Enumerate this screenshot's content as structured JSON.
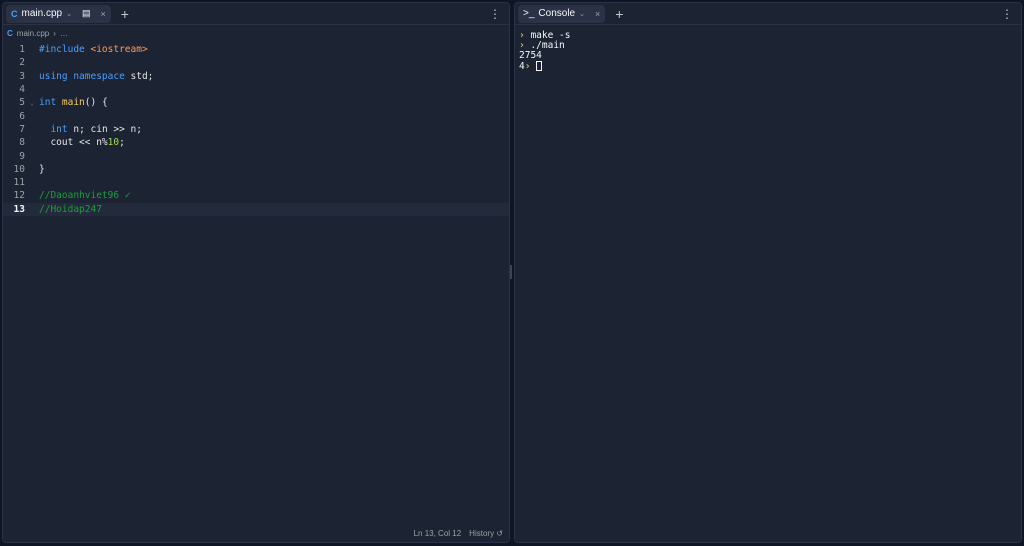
{
  "editor": {
    "tab_label": "main.cpp",
    "breadcrumb": [
      "main.cpp",
      "…"
    ],
    "lines": [
      {
        "n": "1",
        "parts": [
          [
            "kw",
            "#include "
          ],
          [
            "str",
            "<iostream>"
          ]
        ]
      },
      {
        "n": "2",
        "parts": []
      },
      {
        "n": "3",
        "parts": [
          [
            "kw",
            "using namespace "
          ],
          [
            "",
            "std;"
          ]
        ]
      },
      {
        "n": "4",
        "parts": []
      },
      {
        "n": "5",
        "parts": [
          [
            "kw",
            "int "
          ],
          [
            "fn",
            "main"
          ],
          [
            "",
            "() {"
          ]
        ]
      },
      {
        "n": "6",
        "parts": []
      },
      {
        "n": "7",
        "parts": [
          [
            "",
            "  "
          ],
          [
            "kw",
            "int"
          ],
          [
            "",
            " n; cin >> n;"
          ]
        ]
      },
      {
        "n": "8",
        "parts": [
          [
            "",
            "  cout << n%"
          ],
          [
            "num",
            "10"
          ],
          [
            "",
            ";"
          ]
        ]
      },
      {
        "n": "9",
        "parts": []
      },
      {
        "n": "10",
        "parts": [
          [
            "",
            "}"
          ]
        ]
      },
      {
        "n": "11",
        "parts": []
      },
      {
        "n": "12",
        "parts": [
          [
            "cm",
            "//Daoanhviet96 ✓"
          ]
        ]
      },
      {
        "n": "13",
        "parts": [
          [
            "cm",
            "//Hoidap247"
          ]
        ]
      }
    ],
    "status": {
      "position": "Ln 13, Col 12",
      "history": "History"
    }
  },
  "console": {
    "tab_label": "Console",
    "lines": [
      "make -s",
      "./main"
    ],
    "output": "2754",
    "prompt_prefix": "4"
  }
}
